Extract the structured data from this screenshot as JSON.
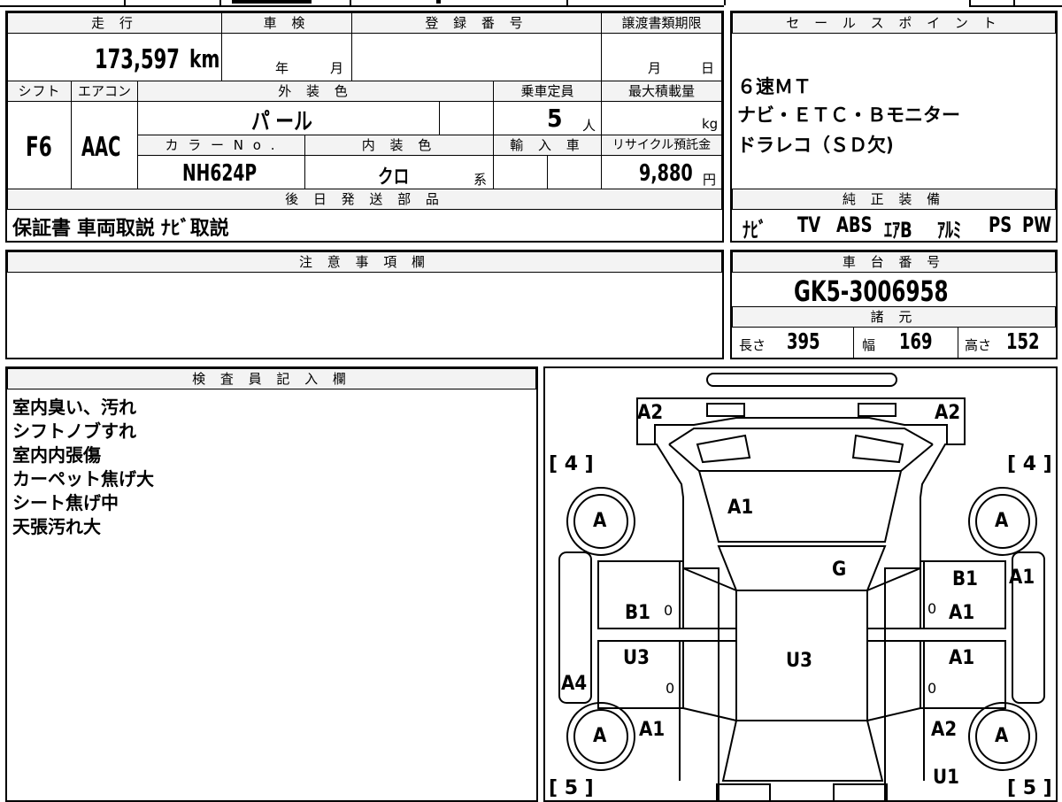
{
  "headers": {
    "mileage": "走 行",
    "inspection": "車 検",
    "registration": "登 録 番 号",
    "transfer_deadline": "譲渡書類期限",
    "shift": "シフト",
    "aircon": "エアコン",
    "exterior_color": "外 装 色",
    "capacity": "乗車定員",
    "max_load": "最大積載量",
    "color_no": "カ ラ ー N o .",
    "interior_color": "内 装 色",
    "import": "輸 入 車",
    "recycle": "リサイクル預託金",
    "later_shipping": "後 日 発 送 部 品",
    "sales_point": "セ ー ル ス ポ イ ン ト",
    "genuine_equipment": "純 正 装 備",
    "notes": "注 意 事 項 欄",
    "chassis_no": "車 台 番 号",
    "specs": "諸 元",
    "inspector_notes": "検 査 員 記 入 欄"
  },
  "values": {
    "mileage": "173,597",
    "mileage_unit": "km",
    "inspection_year": "年",
    "inspection_month": "月",
    "transfer_month": "月",
    "transfer_day": "日",
    "shift": "F6",
    "aircon": "AAC",
    "exterior_color": "パ ール",
    "capacity": "5",
    "capacity_unit": "人",
    "max_load_unit": "kg",
    "color_no": "NH624P",
    "interior_color": "クロ",
    "interior_suffix": "系",
    "recycle": "9,880",
    "recycle_unit": "円",
    "later_shipping": "保証書 車両取説 ﾅﾋﾞ取説",
    "sales_point_lines": [
      "６速ＭＴ",
      "ナビ・ＥＴＣ・Ｂモニター",
      "ドラレコ（ＳＤ欠)"
    ],
    "genuine_equipment": [
      "ﾅﾋﾞ",
      "TV",
      "ABS",
      "ｴｱB",
      "ｱﾙﾐ",
      "PS",
      "PW"
    ],
    "chassis_no": "GK5-3006958",
    "length_label": "長さ",
    "length": "395",
    "width_label": "幅",
    "width": "169",
    "height_label": "高さ",
    "height": "152",
    "inspector_lines": [
      "室内臭い、汚れ",
      "シフトノブすれ",
      "室内内張傷",
      "カーペット焦げ大",
      "シート焦げ中",
      "天張汚れ大"
    ]
  },
  "diagram": {
    "bracket_4_left": "[ 4 ]",
    "bracket_4_right": "[ 4 ]",
    "bracket_5_left": "[ 5 ]",
    "bracket_5_right": "[ 5 ]",
    "wheel": "A",
    "zero": "0",
    "marks": {
      "top_left": "A2",
      "top_right": "A2",
      "hood": "A1",
      "windshield": "G",
      "roof": "U3",
      "left_front_door": "B1",
      "left_rear_door": "U3",
      "left_side": "A4",
      "left_rear_quarter": "A1",
      "right_front_door_top": "B1",
      "right_front_door": "A1",
      "right_rear_door": "A1",
      "right_side": "A1",
      "right_rear_quarter": "A2",
      "right_bottom": "U1"
    }
  }
}
